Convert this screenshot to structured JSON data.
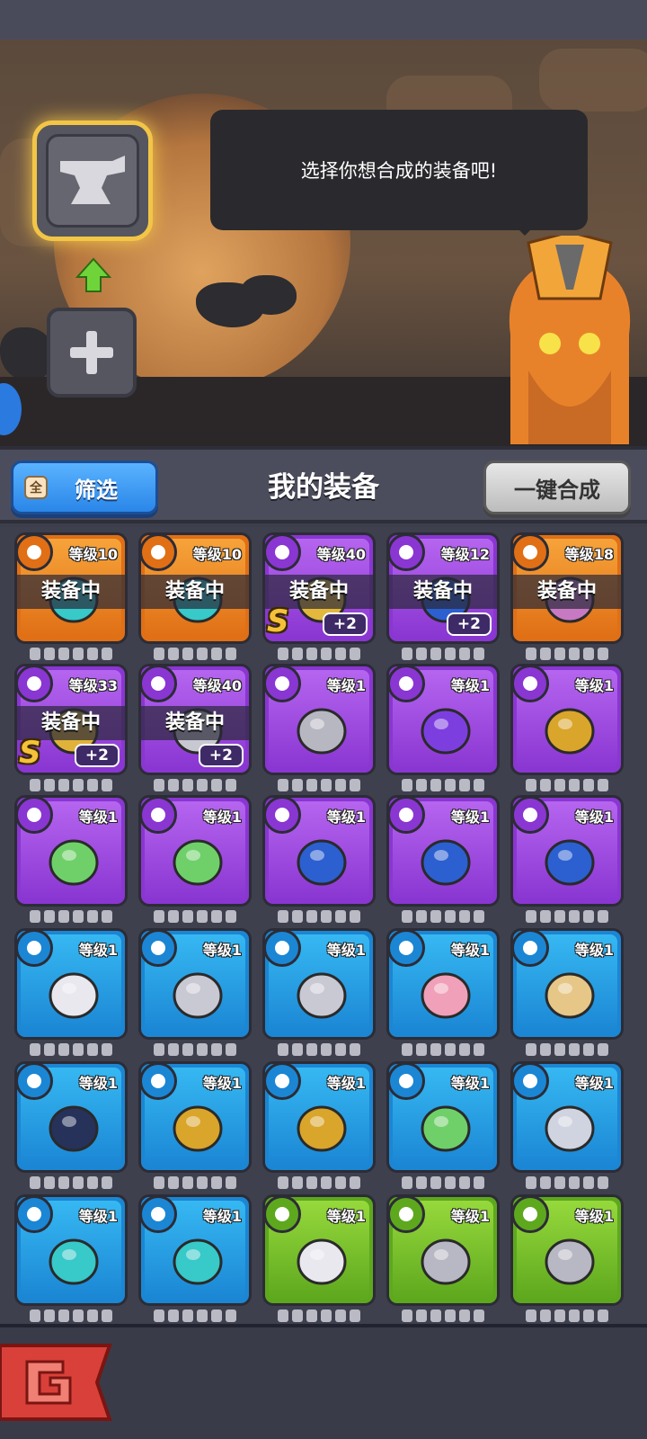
{
  "dialog": {
    "text": "选择你想合成的装备吧!"
  },
  "panel": {
    "filter_badge": "全",
    "filter_label": "筛选",
    "title": "我的装备",
    "merge_label": "一键合成"
  },
  "colors": {
    "orange": "#f08a1f",
    "purple": "#a14be0",
    "blue": "#2aa0e8",
    "green": "#7cc42b"
  },
  "items": [
    {
      "level": "等级10",
      "equipped": "装备中",
      "rarity": "orange",
      "icon": "beast-mask-necklace-icon"
    },
    {
      "level": "等级10",
      "equipped": "装备中",
      "rarity": "orange",
      "icon": "beast-mask-necklace-icon"
    },
    {
      "level": "等级40",
      "equipped": "装备中",
      "rarity": "purple",
      "icon": "gold-amulet-icon",
      "plus": "+2",
      "srank": "S"
    },
    {
      "level": "等级12",
      "equipped": "装备中",
      "rarity": "purple",
      "icon": "sapphire-ring-icon",
      "plus": "+2"
    },
    {
      "level": "等级18",
      "equipped": "装备中",
      "rarity": "orange",
      "icon": "tentacle-ring-icon"
    },
    {
      "level": "等级33",
      "equipped": "装备中",
      "rarity": "purple",
      "icon": "armor-icon",
      "plus": "+2",
      "srank": "S"
    },
    {
      "level": "等级40",
      "equipped": "装备中",
      "rarity": "purple",
      "icon": "cleaver-icon",
      "plus": "+2"
    },
    {
      "level": "等级1",
      "rarity": "purple",
      "icon": "battle-axe-icon"
    },
    {
      "level": "等级1",
      "rarity": "purple",
      "icon": "magic-staff-icon"
    },
    {
      "level": "等级1",
      "rarity": "purple",
      "icon": "golden-armor-icon"
    },
    {
      "level": "等级1",
      "rarity": "purple",
      "icon": "green-orb-ring-icon"
    },
    {
      "level": "等级1",
      "rarity": "purple",
      "icon": "green-orb-ring-icon"
    },
    {
      "level": "等级1",
      "rarity": "purple",
      "icon": "sapphire-ring-icon"
    },
    {
      "level": "等级1",
      "rarity": "purple",
      "icon": "sapphire-ring-icon"
    },
    {
      "level": "等级1",
      "rarity": "purple",
      "icon": "sapphire-ring-icon"
    },
    {
      "level": "等级1",
      "rarity": "blue",
      "icon": "great-axe-icon"
    },
    {
      "level": "等级1",
      "rarity": "blue",
      "icon": "spear-icon"
    },
    {
      "level": "等级1",
      "rarity": "blue",
      "icon": "spear-icon"
    },
    {
      "level": "等级1",
      "rarity": "blue",
      "icon": "bow-icon"
    },
    {
      "level": "等级1",
      "rarity": "blue",
      "icon": "horn-staff-icon"
    },
    {
      "level": "等级1",
      "rarity": "blue",
      "icon": "serpent-staff-icon"
    },
    {
      "level": "等级1",
      "rarity": "blue",
      "icon": "golden-armor-icon"
    },
    {
      "level": "等级1",
      "rarity": "blue",
      "icon": "golden-armor-icon"
    },
    {
      "level": "等级1",
      "rarity": "blue",
      "icon": "green-orb-ring-icon"
    },
    {
      "level": "等级1",
      "rarity": "blue",
      "icon": "silver-mask-necklace-icon"
    },
    {
      "level": "等级1",
      "rarity": "blue",
      "icon": "beast-mask-necklace-icon"
    },
    {
      "level": "等级1",
      "rarity": "blue",
      "icon": "beast-mask-necklace-icon"
    },
    {
      "level": "等级1",
      "rarity": "green",
      "icon": "great-axe-icon"
    },
    {
      "level": "等级1",
      "rarity": "green",
      "icon": "hand-axe-icon"
    },
    {
      "level": "等级1",
      "rarity": "green",
      "icon": "hand-axe-icon"
    }
  ]
}
